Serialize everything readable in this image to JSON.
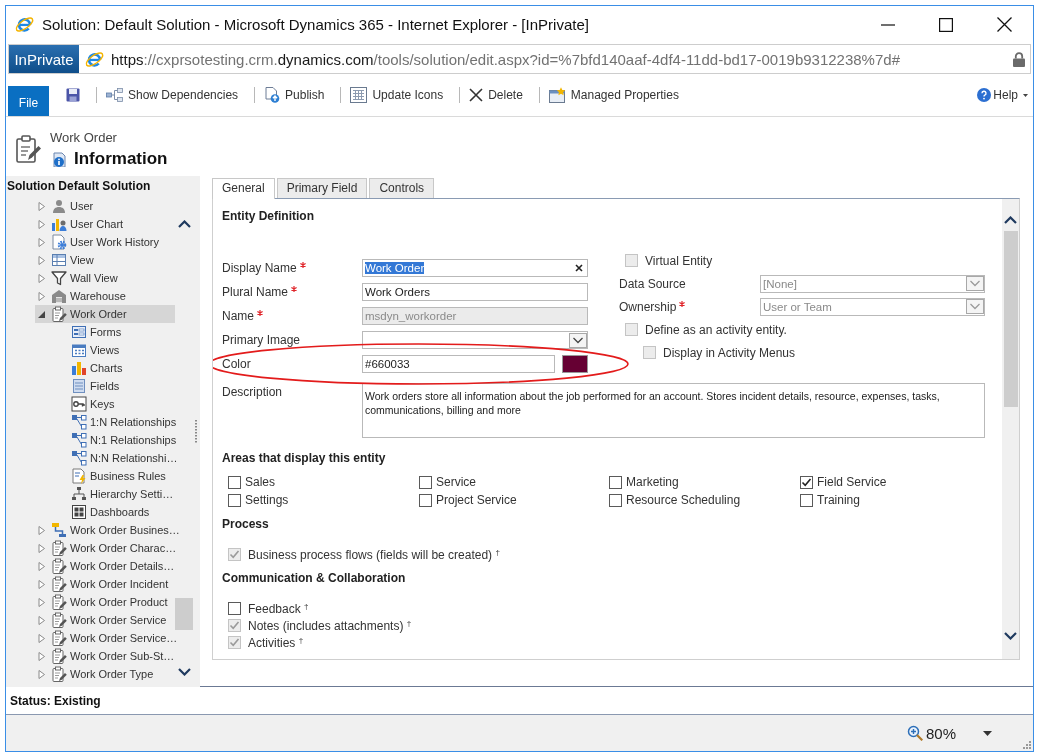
{
  "window": {
    "title": "Solution: Default Solution - Microsoft Dynamics 365 - Internet Explorer - [InPrivate]"
  },
  "address_bar": {
    "badge": "InPrivate",
    "url": [
      {
        "text": "https",
        "emphasis": true
      },
      {
        "text": "://cxprsotesting.crm.",
        "emphasis": false
      },
      {
        "text": "dynamics.com",
        "emphasis": true
      },
      {
        "text": "/tools/solution/edit.aspx?id=%7bfd140aaf-4df4-11dd-bd17-0019b9312238%7d#",
        "emphasis": false
      }
    ]
  },
  "toolbar": {
    "file_tab": "File",
    "items": [
      {
        "kind": "save"
      },
      {
        "kind": "dependencies",
        "label": "Show Dependencies"
      },
      {
        "kind": "publish",
        "label": "Publish"
      },
      {
        "kind": "icons",
        "label": "Update Icons"
      },
      {
        "kind": "delete",
        "label": "Delete"
      },
      {
        "kind": "properties",
        "label": "Managed Properties"
      }
    ],
    "help": "Help"
  },
  "header": {
    "entity": "Work Order",
    "title": "Information"
  },
  "sidebar": {
    "title": "Solution Default Solution",
    "tree": [
      {
        "label": "User",
        "kind": "user",
        "expanded": false,
        "selected": false
      },
      {
        "label": "User Chart",
        "kind": "chart",
        "expanded": false,
        "selected": false
      },
      {
        "label": "User Work History",
        "kind": "history",
        "expanded": false,
        "selected": false
      },
      {
        "label": "View",
        "kind": "view",
        "expanded": false,
        "selected": false
      },
      {
        "label": "Wall View",
        "kind": "filter",
        "expanded": false,
        "selected": false
      },
      {
        "label": "Warehouse",
        "kind": "warehouse",
        "expanded": false,
        "selected": false
      },
      {
        "label": "Work Order",
        "kind": "entity",
        "expanded": true,
        "selected": true,
        "children": [
          {
            "label": "Forms",
            "kind": "forms",
            "selected": false
          },
          {
            "label": "Views",
            "kind": "views",
            "selected": false
          },
          {
            "label": "Charts",
            "kind": "charts",
            "selected": false
          },
          {
            "label": "Fields",
            "kind": "fields",
            "selected": false
          },
          {
            "label": "Keys",
            "kind": "keys",
            "selected": false
          },
          {
            "label": "1:N Relationships",
            "kind": "relationship",
            "selected": false
          },
          {
            "label": "N:1 Relationships",
            "kind": "relationship",
            "selected": false
          },
          {
            "label": "N:N Relationshi…",
            "kind": "relationship",
            "selected": false
          },
          {
            "label": "Business Rules",
            "kind": "rules",
            "selected": false
          },
          {
            "label": "Hierarchy Setti…",
            "kind": "hierarchy",
            "selected": false
          },
          {
            "label": "Dashboards",
            "kind": "dashboards",
            "selected": false
          }
        ]
      },
      {
        "label": "Work Order Busines…",
        "kind": "process",
        "expanded": false,
        "selected": false
      },
      {
        "label": "Work Order Charac…",
        "kind": "entity",
        "expanded": false,
        "selected": false
      },
      {
        "label": "Work Order Details…",
        "kind": "entity",
        "expanded": false,
        "selected": false
      },
      {
        "label": "Work Order Incident",
        "kind": "entity",
        "expanded": false,
        "selected": false
      },
      {
        "label": "Work Order Product",
        "kind": "entity",
        "expanded": false,
        "selected": false
      },
      {
        "label": "Work Order Service",
        "kind": "entity",
        "expanded": false,
        "selected": false
      },
      {
        "label": "Work Order Service…",
        "kind": "entity",
        "expanded": false,
        "selected": false
      },
      {
        "label": "Work Order Sub-St…",
        "kind": "entity",
        "expanded": false,
        "selected": false
      },
      {
        "label": "Work Order Type",
        "kind": "entity",
        "expanded": false,
        "selected": false
      }
    ]
  },
  "tabs": [
    {
      "label": "General",
      "selected": true
    },
    {
      "label": "Primary Field",
      "selected": false
    },
    {
      "label": "Controls",
      "selected": false
    }
  ],
  "entity_definition": {
    "title": "Entity Definition",
    "fields": [
      {
        "kind": "text",
        "label": "Display Name",
        "value": "Work Order",
        "required": true,
        "disabled": false,
        "focused": true,
        "circled": false
      },
      {
        "kind": "text",
        "label": "Plural Name",
        "value": "Work Orders",
        "required": true,
        "disabled": false,
        "focused": false,
        "circled": false
      },
      {
        "kind": "text",
        "label": "Name",
        "value": "msdyn_workorder",
        "required": true,
        "disabled": true,
        "focused": false,
        "circled": false
      },
      {
        "kind": "select",
        "label": "Primary Image",
        "required": false,
        "disabled": false,
        "focused": false,
        "circled": false
      },
      {
        "kind": "color",
        "label": "Color",
        "value": "#660033",
        "color": "#660033",
        "required": false,
        "disabled": false,
        "focused": false,
        "circled": true
      }
    ],
    "settings": [
      {
        "kind": "checkbox",
        "label": "Virtual Entity",
        "checked": false,
        "disabled": true,
        "required": false
      },
      {
        "kind": "select",
        "label": "Data Source",
        "value": "[None]",
        "required": false,
        "disabled": true,
        "focused": false
      },
      {
        "kind": "select",
        "label": "Ownership",
        "value": "User or Team",
        "required": true,
        "disabled": true,
        "focused": false
      },
      {
        "kind": "checkbox",
        "label": "Define as an activity entity.",
        "checked": false,
        "disabled": true,
        "required": false,
        "children": [
          {
            "kind": "checkbox",
            "label": "Display in Activity Menus",
            "checked": false,
            "disabled": true,
            "required": false
          }
        ]
      }
    ],
    "description": {
      "label": "Description",
      "required": false,
      "value": "Work orders store all information about the job performed for an account. Stores incident details, resource, expenses, tasks, communications, billing and more"
    }
  },
  "sections": [
    {
      "kind": "grid",
      "title": "Areas that display this entity",
      "options": [
        {
          "label": "Sales",
          "checked": false,
          "disabled": false
        },
        {
          "label": "Service",
          "checked": false,
          "disabled": false
        },
        {
          "label": "Marketing",
          "checked": false,
          "disabled": false
        },
        {
          "label": "Field Service",
          "checked": true,
          "disabled": false
        },
        {
          "label": "Settings",
          "checked": false,
          "disabled": false
        },
        {
          "label": "Project Service",
          "checked": false,
          "disabled": false
        },
        {
          "label": "Resource Scheduling",
          "checked": false,
          "disabled": false
        },
        {
          "label": "Training",
          "checked": false,
          "disabled": false
        }
      ]
    },
    {
      "kind": "list",
      "title": "Process",
      "options": [
        {
          "label": "Business process flows (fields will be created) $^{†}$",
          "checked": true,
          "disabled": true
        }
      ]
    },
    {
      "kind": "list",
      "title": "Communication & Collaboration",
      "options": [
        {
          "label": "Feedback $^{†}$",
          "checked": false,
          "disabled": false
        },
        {
          "label": "Notes (includes attachments) $^{†}$",
          "checked": true,
          "disabled": true
        },
        {
          "label": "Activities $^{†}$",
          "checked": true,
          "disabled": true
        }
      ]
    }
  ],
  "status_bar": {
    "status": "Status: Existing",
    "zoom": "80%"
  }
}
